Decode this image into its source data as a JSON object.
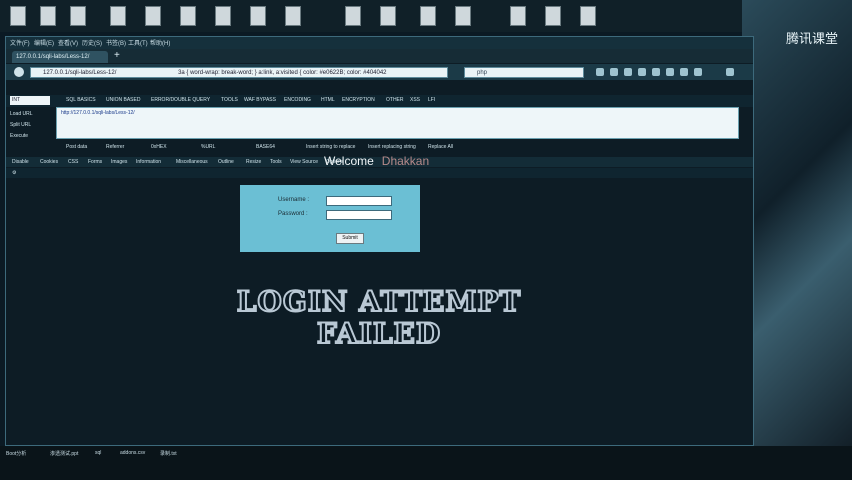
{
  "desktop": {
    "right_text": "腾讯课堂"
  },
  "browser": {
    "menu": [
      "文件(F)",
      "编辑(E)",
      "查看(V)",
      "历史(S)",
      "书签(B)",
      "工具(T)",
      "帮助(H)"
    ],
    "tab_title": "127.0.0.1/sqli-labs/Less-12/",
    "url": "127.0.0.1/sqli-labs/Less-12/",
    "url_extra": "3a { word-wrap: break-word; } a:link, a:visited { color: #e0622B; color: #404042",
    "search_value": "php"
  },
  "hackbar": {
    "select_value": "INT",
    "menu": [
      "SQL BASICS",
      "UNION BASED",
      "ERROR/DOUBLE QUERY",
      "TOOLS",
      "WAF BYPASS",
      "ENCODING",
      "HTML",
      "ENCRYPTION",
      "OTHER",
      "XSS",
      "LFI"
    ],
    "left": [
      "Load URL",
      "Split URL",
      "Execute"
    ],
    "textarea": "http://127.0.0.1/sqli-labs/Less-12/",
    "options": [
      "Post data",
      "Referrer",
      "0xHEX",
      "%URL",
      "BASE64",
      "Insert string to replace",
      "Insert replacing string",
      "Replace All"
    ]
  },
  "firebug": {
    "items": [
      "Disable",
      "Cookies",
      "CSS",
      "Forms",
      "Images",
      "Information",
      "Miscellaneous",
      "Outline",
      "Resize",
      "Tools",
      "View Source",
      "Options"
    ]
  },
  "page": {
    "welcome": "Welcome",
    "user": "Dhakkan",
    "username_label": "Username :",
    "password_label": "Password :",
    "submit_label": "Submit",
    "fail_line1": "LOGIN ATTEMPT",
    "fail_line2": "FAILED"
  },
  "taskbar": {
    "items": [
      "Boot分析",
      "渗透测试.ppt",
      "sql",
      "addons.csv",
      "录制.txt"
    ]
  }
}
